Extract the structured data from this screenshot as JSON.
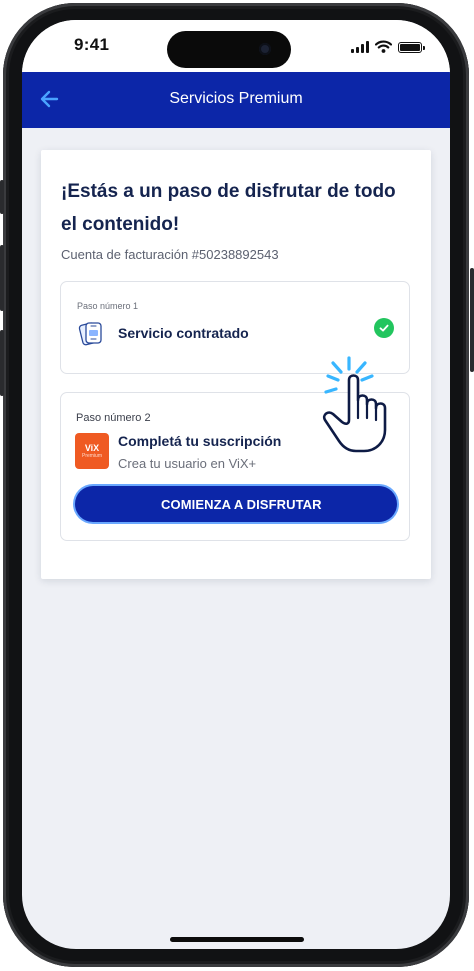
{
  "status_bar": {
    "time": "9:41",
    "icons": [
      "signal-icon",
      "wifi-icon",
      "battery-icon"
    ]
  },
  "header": {
    "title": "Servicios Premium",
    "back_icon": "arrow-left-icon"
  },
  "card": {
    "headline": "¡Estás a un paso de disfrutar de todo el contenido!",
    "account": "Cuenta de facturación #50238892543",
    "step1": {
      "label": "Paso número 1",
      "title": "Servicio contratado",
      "icon": "app-devices-icon",
      "status_icon": "check-icon"
    },
    "step2": {
      "label": "Paso número 2",
      "title": "Completá tu suscripción",
      "subtitle": "Crea tu usuario en ViX+",
      "logo_text": "ViX",
      "logo_small": "Premium",
      "button": "COMIENZA A DISFRUTAR",
      "cursor_icon": "hand-pointer-icon"
    }
  },
  "colors": {
    "brand_blue": "#0c26a8",
    "title_navy": "#15244f",
    "success_green": "#22c55e",
    "vix_orange": "#ef5a22",
    "cursor_highlight": "#38b6ff"
  }
}
